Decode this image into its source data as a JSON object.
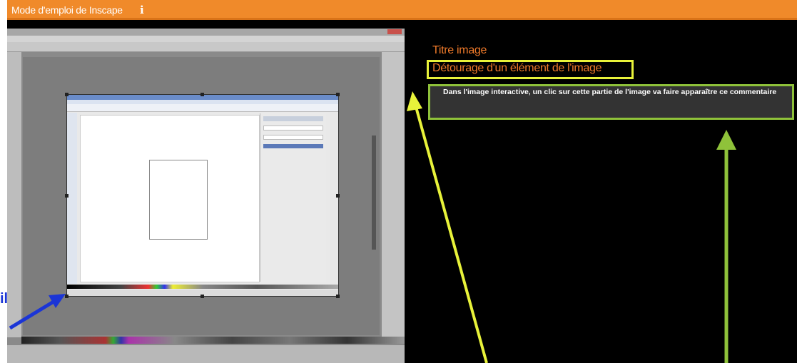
{
  "window": {
    "title": "Mode d'emploi de Inscape",
    "info_icon": "i"
  },
  "panel": {
    "image_title": "Titre image",
    "element_title": "Détourage d'un élément de l'image",
    "comment": "Dans l'image interactive, un clic sur cette partie de l'image va faire apparaître ce commentaire"
  },
  "annotation": {
    "left_label_fragment": "il"
  },
  "colors": {
    "titlebar": "#f08a2a",
    "title_text": "#f07a2a",
    "highlight_yellow": "#e8f23a",
    "highlight_green": "#8fc23a",
    "arrow_blue": "#1b35d6",
    "background": "#000000"
  },
  "icons": {
    "info": "info-icon",
    "arrow_blue": "arrow-blue-icon",
    "arrow_yellow": "arrow-yellow-icon",
    "arrow_green": "arrow-green-icon"
  }
}
